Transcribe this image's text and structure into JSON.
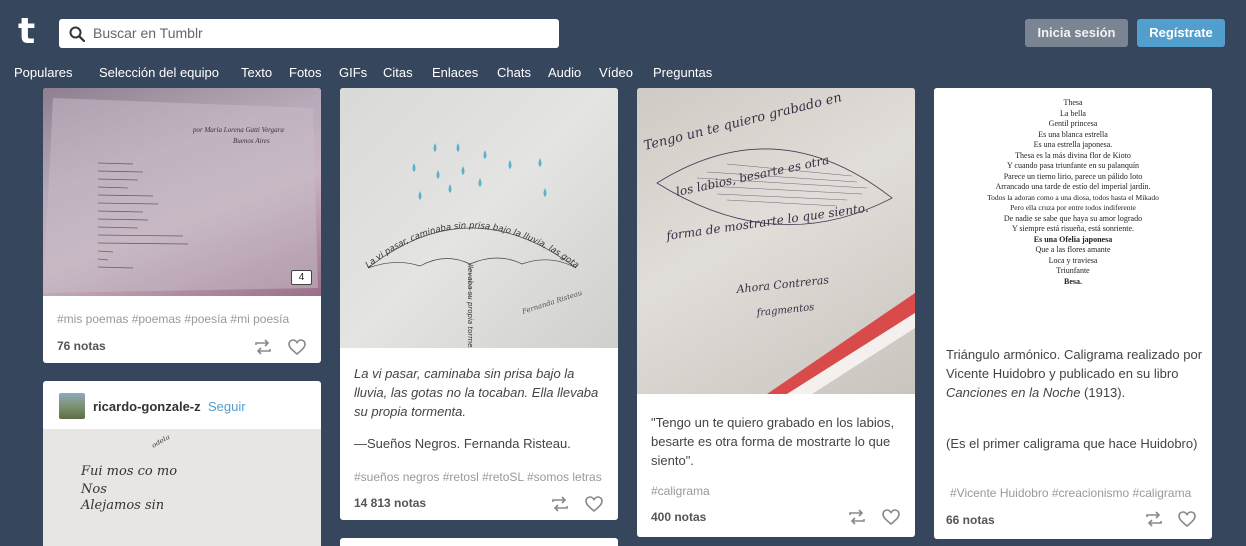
{
  "header": {
    "logo": "t",
    "search_placeholder": "Buscar en Tumblr",
    "login_label": "Inicia sesión",
    "signup_label": "Regístrate"
  },
  "nav": [
    "Populares",
    "Selección del equipo",
    "Texto",
    "Fotos",
    "GIFs",
    "Citas",
    "Enlaces",
    "Chats",
    "Audio",
    "Vídeo",
    "Preguntas"
  ],
  "posts": {
    "p1": {
      "tags": "#mis poemas  #poemas  #poesía  #mi poesía",
      "notes": "76 notas",
      "photo_count": "4",
      "book_author": "por María Lorena Gatti Vergara",
      "book_city": "Buenos Aires"
    },
    "p2": {
      "username": "ricardo-gonzale-z",
      "follow_label": "Seguir",
      "handwriting": [
        "Fui mos co mo",
        "Nos",
        "Alejamos sin"
      ]
    },
    "p3": {
      "caption_italic": "La vi pasar, caminaba sin prisa bajo la lluvia, las gotas no la tocaban. Ella llevaba su propia tormenta.",
      "caption_source": "—Sueños Negros. Fernanda Risteau.",
      "tags": "#sueños negros  #retosl  #retoSL  #somos letras",
      "notes": "14 813 notas",
      "umbrella_text": "La vi pasar, caminaba sin prisa bajo la lluvia, las gotas no la tocaban, ella",
      "handle_text": "llevaba su propia tormenta",
      "signature": "Fernanda Risteau"
    },
    "p4": {
      "caption": "\"Tengo un te quiero grabado en los labios, besarte es otra forma de mostrarte lo que siento\".",
      "tags": "#caligrama",
      "notes": "400 notas",
      "image_text": [
        "Tengo un te quiero grabado en",
        "los labios, besarte es otra",
        "forma de mostrarte lo que siento."
      ],
      "signature": [
        "Ahora Contreras",
        "fragmentos"
      ]
    },
    "p5": {
      "poem": [
        "Thesa",
        "La   bella",
        "Gentil  princesa",
        "Es una blanca estrella",
        "Es  una  estrella  japonesa.",
        "Thesa es la más divina flor de Kioto",
        "Y cuando pasa triunfante en su palanquín",
        "Parece  un  tierno  lirio,  parece  un  pálido  loto",
        "Arrancado  una  tarde  de  estío  del  imperial  jardín.",
        "Todos  la  adoran  como  a  una  diosa,  todos  hasta  el  Mikado",
        "Pero   ella   cruza   por   entre   todos   indiferente",
        "De  nadie  se  sabe  que  haya  su  amor  logrado",
        "Y  siempre  está  risueña,  está  sonriente.",
        "Es    una    Ofelia    japonesa",
        "Que a las flores amante",
        "Loca y traviesa",
        "Triunfante",
        "Besa."
      ],
      "caption_a": "Triángulo armónico. Caligrama realizado por Vicente Huidobro y publicado en su libro ",
      "caption_book": "Canciones en la Noche",
      "caption_b": " (1913).",
      "caption_note": "(Es el primer caligrama que hace Huidobro)",
      "tags": "#Vicente Huidobro  #creacionismo  #caligrama",
      "notes": "66 notas"
    }
  },
  "colors": {
    "background": "#36465d",
    "accent": "#529ecc",
    "login_button": "#7b8493"
  }
}
